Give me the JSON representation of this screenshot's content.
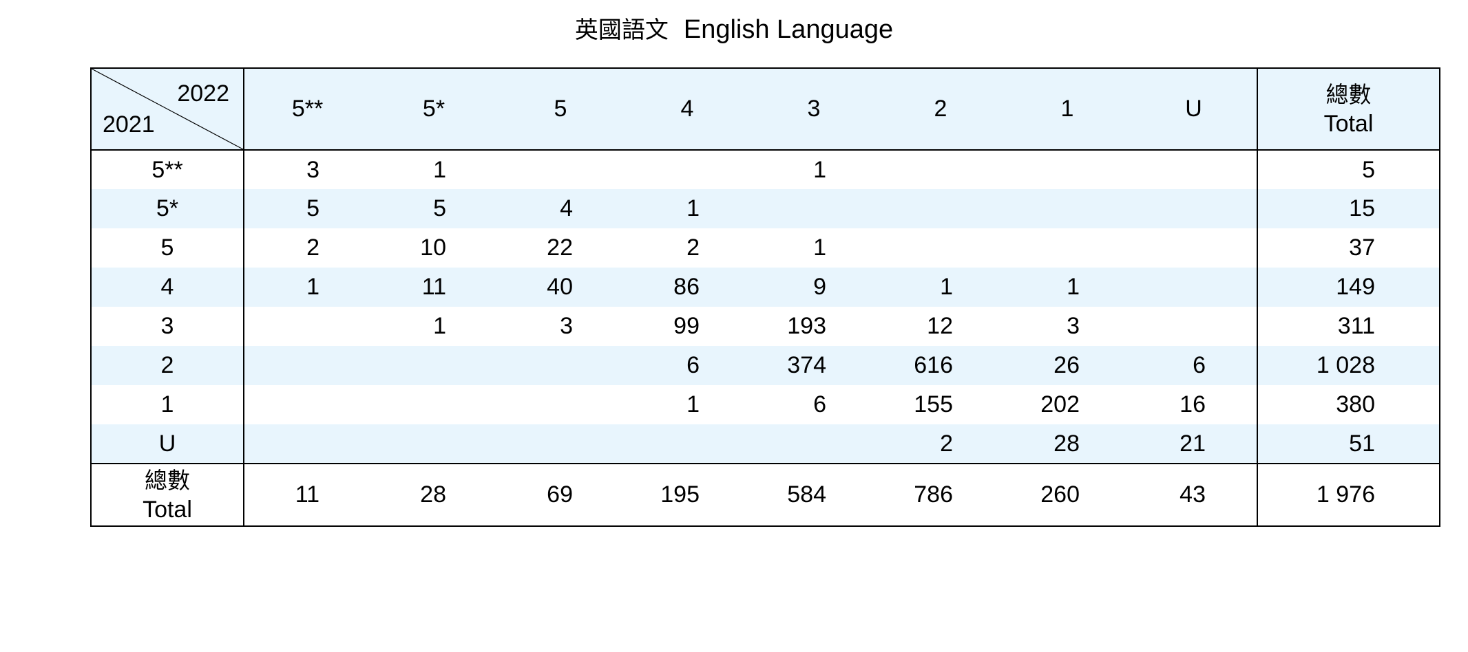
{
  "title": {
    "zh": "英國語文",
    "en": "English Language"
  },
  "corner": {
    "top_label": "2022",
    "bottom_label": "2021"
  },
  "columns": [
    "5**",
    "5*",
    "5",
    "4",
    "3",
    "2",
    "1",
    "U"
  ],
  "total_label": {
    "zh": "總數",
    "en": "Total"
  },
  "rows": [
    {
      "label": "5**",
      "cells": [
        "3",
        "1",
        "",
        "",
        "1",
        "",
        "",
        ""
      ],
      "total": "5"
    },
    {
      "label": "5*",
      "cells": [
        "5",
        "5",
        "4",
        "1",
        "",
        "",
        "",
        ""
      ],
      "total": "15"
    },
    {
      "label": "5",
      "cells": [
        "2",
        "10",
        "22",
        "2",
        "1",
        "",
        "",
        ""
      ],
      "total": "37"
    },
    {
      "label": "4",
      "cells": [
        "1",
        "11",
        "40",
        "86",
        "9",
        "1",
        "1",
        ""
      ],
      "total": "149"
    },
    {
      "label": "3",
      "cells": [
        "",
        "1",
        "3",
        "99",
        "193",
        "12",
        "3",
        ""
      ],
      "total": "311"
    },
    {
      "label": "2",
      "cells": [
        "",
        "",
        "",
        "6",
        "374",
        "616",
        "26",
        "6"
      ],
      "total": "1 028"
    },
    {
      "label": "1",
      "cells": [
        "",
        "",
        "",
        "1",
        "6",
        "155",
        "202",
        "16"
      ],
      "total": "380"
    },
    {
      "label": "U",
      "cells": [
        "",
        "",
        "",
        "",
        "",
        "2",
        "28",
        "21"
      ],
      "total": "51"
    }
  ],
  "totals_row": {
    "cells": [
      "11",
      "28",
      "69",
      "195",
      "584",
      "786",
      "260",
      "43"
    ],
    "total": "1 976"
  },
  "colors": {
    "band": "#e8f5fd",
    "border": "#000000"
  }
}
